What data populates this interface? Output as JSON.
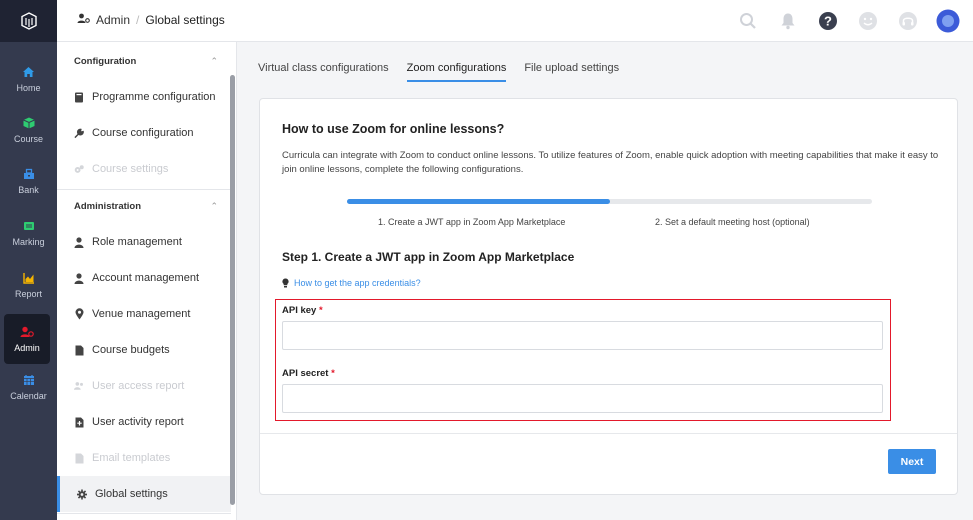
{
  "rail": {
    "items": [
      {
        "label": "Home",
        "icon": "home-icon"
      },
      {
        "label": "Course",
        "icon": "cube-icon"
      },
      {
        "label": "Bank",
        "icon": "bank-icon"
      },
      {
        "label": "Marking",
        "icon": "marking-icon"
      },
      {
        "label": "Report",
        "icon": "chart-icon"
      },
      {
        "label": "Admin",
        "icon": "admin-icon"
      },
      {
        "label": "Calendar",
        "icon": "calendar-icon"
      }
    ],
    "colors": {
      "home": "#2f9be8",
      "course": "#2ecc71",
      "bank": "#3a8ee6",
      "marking": "#2ecc71",
      "report": "#f5b400",
      "admin": "#e3192b",
      "calendar": "#3a8ee6"
    }
  },
  "breadcrumb": {
    "root": "Admin",
    "separator": "/",
    "current": "Global settings"
  },
  "sidemenu": {
    "sections": [
      {
        "title": "Configuration",
        "items": [
          {
            "label": "Programme configuration",
            "icon": "book-icon",
            "enabled": true
          },
          {
            "label": "Course configuration",
            "icon": "wrench-icon",
            "enabled": true
          },
          {
            "label": "Course settings",
            "icon": "gears-icon",
            "enabled": false
          }
        ]
      },
      {
        "title": "Administration",
        "items": [
          {
            "label": "Role management",
            "icon": "user-icon",
            "enabled": true
          },
          {
            "label": "Account management",
            "icon": "user-icon",
            "enabled": true
          },
          {
            "label": "Venue management",
            "icon": "pin-icon",
            "enabled": true
          },
          {
            "label": "Course budgets",
            "icon": "file-icon",
            "enabled": true
          },
          {
            "label": "User access report",
            "icon": "users-icon",
            "enabled": false
          },
          {
            "label": "User activity report",
            "icon": "file-plus-icon",
            "enabled": true
          },
          {
            "label": "Email templates",
            "icon": "email-icon",
            "enabled": false
          },
          {
            "label": "Global settings",
            "icon": "gear-icon",
            "enabled": true,
            "active": true
          }
        ]
      }
    ]
  },
  "tabs": [
    {
      "label": "Virtual class configurations",
      "active": false
    },
    {
      "label": "Zoom configurations",
      "active": true
    },
    {
      "label": "File upload settings",
      "active": false
    }
  ],
  "card": {
    "title": "How to use Zoom for online lessons?",
    "description": "Curricula can integrate with Zoom to conduct online lessons. To utilize features of Zoom, enable quick adoption with meeting capabilities that make it easy to join online lessons, complete the following configurations.",
    "progress": 0.5,
    "steps": [
      "1. Create a JWT app in Zoom App Marketplace",
      "2. Set a default meeting host (optional)"
    ],
    "step_title": "Step 1. Create a JWT app in Zoom App Marketplace",
    "help_link": "How to get the app credentials?",
    "fields": [
      {
        "label": "API key",
        "required_mark": "*",
        "value": "",
        "placeholder": ""
      },
      {
        "label": "API secret",
        "required_mark": "*",
        "value": "",
        "placeholder": ""
      }
    ],
    "next_label": "Next"
  },
  "accent_color": "#3a8ee6"
}
